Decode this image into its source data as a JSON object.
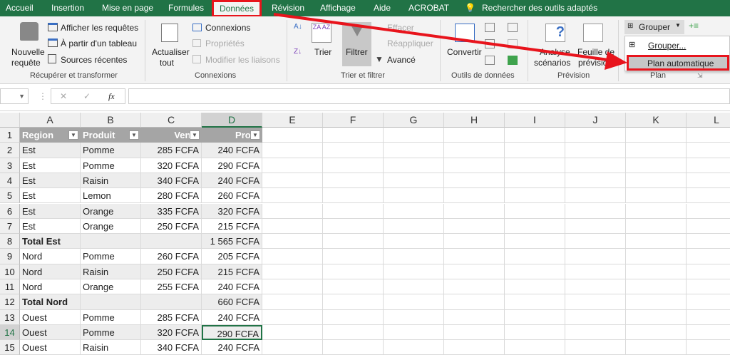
{
  "tabs": [
    "Accueil",
    "Insertion",
    "Mise en page",
    "Formules",
    "Données",
    "Révision",
    "Affichage",
    "Aide",
    "ACROBAT",
    "Rechercher des outils adaptés"
  ],
  "ribbon": {
    "get_transform": {
      "new_query": [
        "Nouvelle",
        "requête"
      ],
      "show_queries": "Afficher les requêtes",
      "from_table": "À partir d'un tableau",
      "recent_sources": "Sources récentes",
      "label": "Récupérer et transformer"
    },
    "connections": {
      "refresh": [
        "Actualiser",
        "tout"
      ],
      "connections": "Connexions",
      "properties": "Propriétés",
      "edit_links": "Modifier les liaisons",
      "label": "Connexions"
    },
    "sort_filter": {
      "sort": "Trier",
      "filter": "Filtrer",
      "clear": "Effacer",
      "reapply": "Réappliquer",
      "advanced": "Avancé",
      "label": "Trier et filtrer"
    },
    "data_tools": {
      "convert": "Convertir",
      "label": "Outils de données"
    },
    "forecast": {
      "scenarios": [
        "Analyse",
        "scénarios"
      ],
      "forecast_sheet": [
        "Feuille de",
        "prévision"
      ],
      "label": "Prévision"
    },
    "outline": {
      "group": "Grouper",
      "label": "Plan"
    }
  },
  "menu": {
    "items": [
      "Grouper...",
      "Plan automatique"
    ]
  },
  "formula_bar": {
    "fx": "fx",
    "value": ""
  },
  "columns": [
    "A",
    "B",
    "C",
    "D",
    "E",
    "F",
    "G",
    "H",
    "I",
    "J",
    "K",
    "L"
  ],
  "rows": [
    [
      "Region",
      "Produit",
      "Vente",
      "Profit"
    ],
    [
      "Est",
      "Pomme",
      "285 FCFA",
      "240 FCFA"
    ],
    [
      "Est",
      "Pomme",
      "320 FCFA",
      "290 FCFA"
    ],
    [
      "Est",
      "Raisin",
      "340 FCFA",
      "240 FCFA"
    ],
    [
      "Est",
      "Lemon",
      "280 FCFA",
      "260 FCFA"
    ],
    [
      "Est",
      "Orange",
      "335 FCFA",
      "320 FCFA"
    ],
    [
      "Est",
      "Orange",
      "250 FCFA",
      "215 FCFA"
    ],
    [
      "Total Est",
      "",
      "",
      "1 565 FCFA"
    ],
    [
      "Nord",
      "Pomme",
      "260 FCFA",
      "205 FCFA"
    ],
    [
      "Nord",
      "Raisin",
      "250 FCFA",
      "215 FCFA"
    ],
    [
      "Nord",
      "Orange",
      "255 FCFA",
      "240 FCFA"
    ],
    [
      "Total Nord",
      "",
      "",
      "660 FCFA"
    ],
    [
      "Ouest",
      "Pomme",
      "285 FCFA",
      "240 FCFA"
    ],
    [
      "Ouest",
      "Pomme",
      "320 FCFA",
      "290 FCFA"
    ],
    [
      "Ouest",
      "Raisin",
      "340 FCFA",
      "240 FCFA"
    ]
  ],
  "selected_cell": "D14",
  "colors": {
    "ribbon_green": "#217346",
    "annotation_red": "#e8141c",
    "header_gray": "#a5a5a5"
  }
}
